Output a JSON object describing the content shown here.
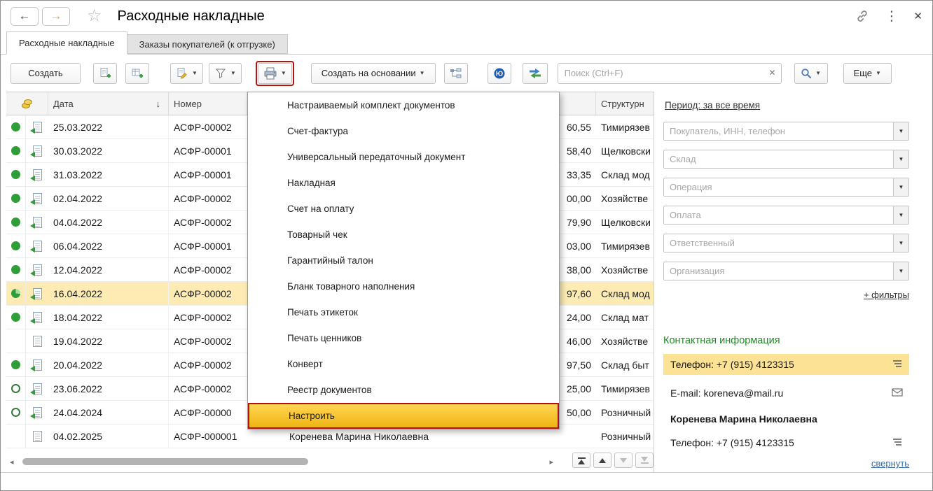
{
  "titlebar": {
    "title": "Расходные накладные"
  },
  "tabs": [
    {
      "label": "Расходные накладные",
      "active": true
    },
    {
      "label": "Заказы покупателей (к отгрузке)",
      "active": false
    }
  ],
  "toolbar": {
    "create": "Создать",
    "create_based_on": "Создать на основании",
    "search_placeholder": "Поиск (Ctrl+F)",
    "more": "Еще"
  },
  "table": {
    "headers": {
      "date": "Дата",
      "number": "Номер",
      "struct": "Структурн"
    },
    "rows": [
      {
        "status": "posted",
        "doc": "green",
        "date": "25.03.2022",
        "number": "АСФР-00002",
        "customer": "",
        "sum": "60,55",
        "struct": "Тимирязев"
      },
      {
        "status": "posted",
        "doc": "green",
        "date": "30.03.2022",
        "number": "АСФР-00001",
        "customer": "",
        "sum": "58,40",
        "struct": "Щелковски"
      },
      {
        "status": "posted",
        "doc": "green",
        "date": "31.03.2022",
        "number": "АСФР-00001",
        "customer": "",
        "sum": "33,35",
        "struct": "Склад мод"
      },
      {
        "status": "posted",
        "doc": "green",
        "date": "02.04.2022",
        "number": "АСФР-00002",
        "customer": "",
        "sum": "00,00",
        "struct": "Хозяйстве"
      },
      {
        "status": "posted",
        "doc": "green",
        "date": "04.04.2022",
        "number": "АСФР-00002",
        "customer": "",
        "sum": "79,90",
        "struct": "Щелковски"
      },
      {
        "status": "posted",
        "doc": "green",
        "date": "06.04.2022",
        "number": "АСФР-00001",
        "customer": "",
        "sum": "03,00",
        "struct": "Тимирязев"
      },
      {
        "status": "posted",
        "doc": "green",
        "date": "12.04.2022",
        "number": "АСФР-00002",
        "customer": "",
        "sum": "38,00",
        "struct": "Хозяйстве"
      },
      {
        "status": "partial",
        "doc": "green",
        "date": "16.04.2022",
        "number": "АСФР-00002",
        "customer": "",
        "sum": "97,60",
        "struct": "Склад мод",
        "selected": true
      },
      {
        "status": "posted",
        "doc": "green",
        "date": "18.04.2022",
        "number": "АСФР-00002",
        "customer": "",
        "sum": "24,00",
        "struct": "Склад мат"
      },
      {
        "status": "none",
        "doc": "gray",
        "date": "19.04.2022",
        "number": "АСФР-00002",
        "customer": "",
        "sum": "46,00",
        "struct": "Хозяйстве"
      },
      {
        "status": "posted",
        "doc": "green",
        "date": "20.04.2022",
        "number": "АСФР-00002",
        "customer": "",
        "sum": "97,50",
        "struct": "Склад быт"
      },
      {
        "status": "hollow",
        "doc": "green",
        "date": "23.06.2022",
        "number": "АСФР-00002",
        "customer": "",
        "sum": "25,00",
        "struct": "Тимирязев"
      },
      {
        "status": "hollow",
        "doc": "green",
        "date": "24.04.2024",
        "number": "АСФР-00000",
        "customer": "",
        "sum": "50,00",
        "struct": "Розничный"
      },
      {
        "status": "none",
        "doc": "gray",
        "date": "04.02.2025",
        "number": "АСФР-000001",
        "customer": "Коренева Марина Николаевна",
        "sum": "",
        "struct": "Розничный"
      }
    ]
  },
  "menu": {
    "items": [
      "Настраиваемый комплект документов",
      "Счет-фактура",
      "Универсальный передаточный документ",
      "Накладная",
      "Счет на оплату",
      "Товарный чек",
      "Гарантийный талон",
      "Бланк товарного наполнения",
      "Печать этикеток",
      "Печать ценников",
      "Конверт",
      "Реестр документов"
    ],
    "highlighted_item": "Настроить"
  },
  "filters": {
    "period": "Период: за все время",
    "fields": [
      "Покупатель, ИНН, телефон",
      "Склад",
      "Операция",
      "Оплата",
      "Ответственный",
      "Организация"
    ],
    "more": "+ фильтры"
  },
  "contact": {
    "title": "Контактная информация",
    "phone_highlighted": "Телефон: +7 (915) 4123315",
    "email": "E-mail: koreneva@mail.ru",
    "person": "Коренева Марина Николаевна",
    "phone": "Телефон: +7 (915) 4123315",
    "collapse": "свернуть"
  },
  "colors": {
    "highlight_red": "#b3130f",
    "menu_highlight_yellow": "#f5c22e",
    "selected_row": "#fcecb4",
    "posted_green": "#2f9e38",
    "contact_green": "#1f8b24",
    "contact_highlight": "#fce294",
    "link_blue": "#3a6ea5"
  }
}
